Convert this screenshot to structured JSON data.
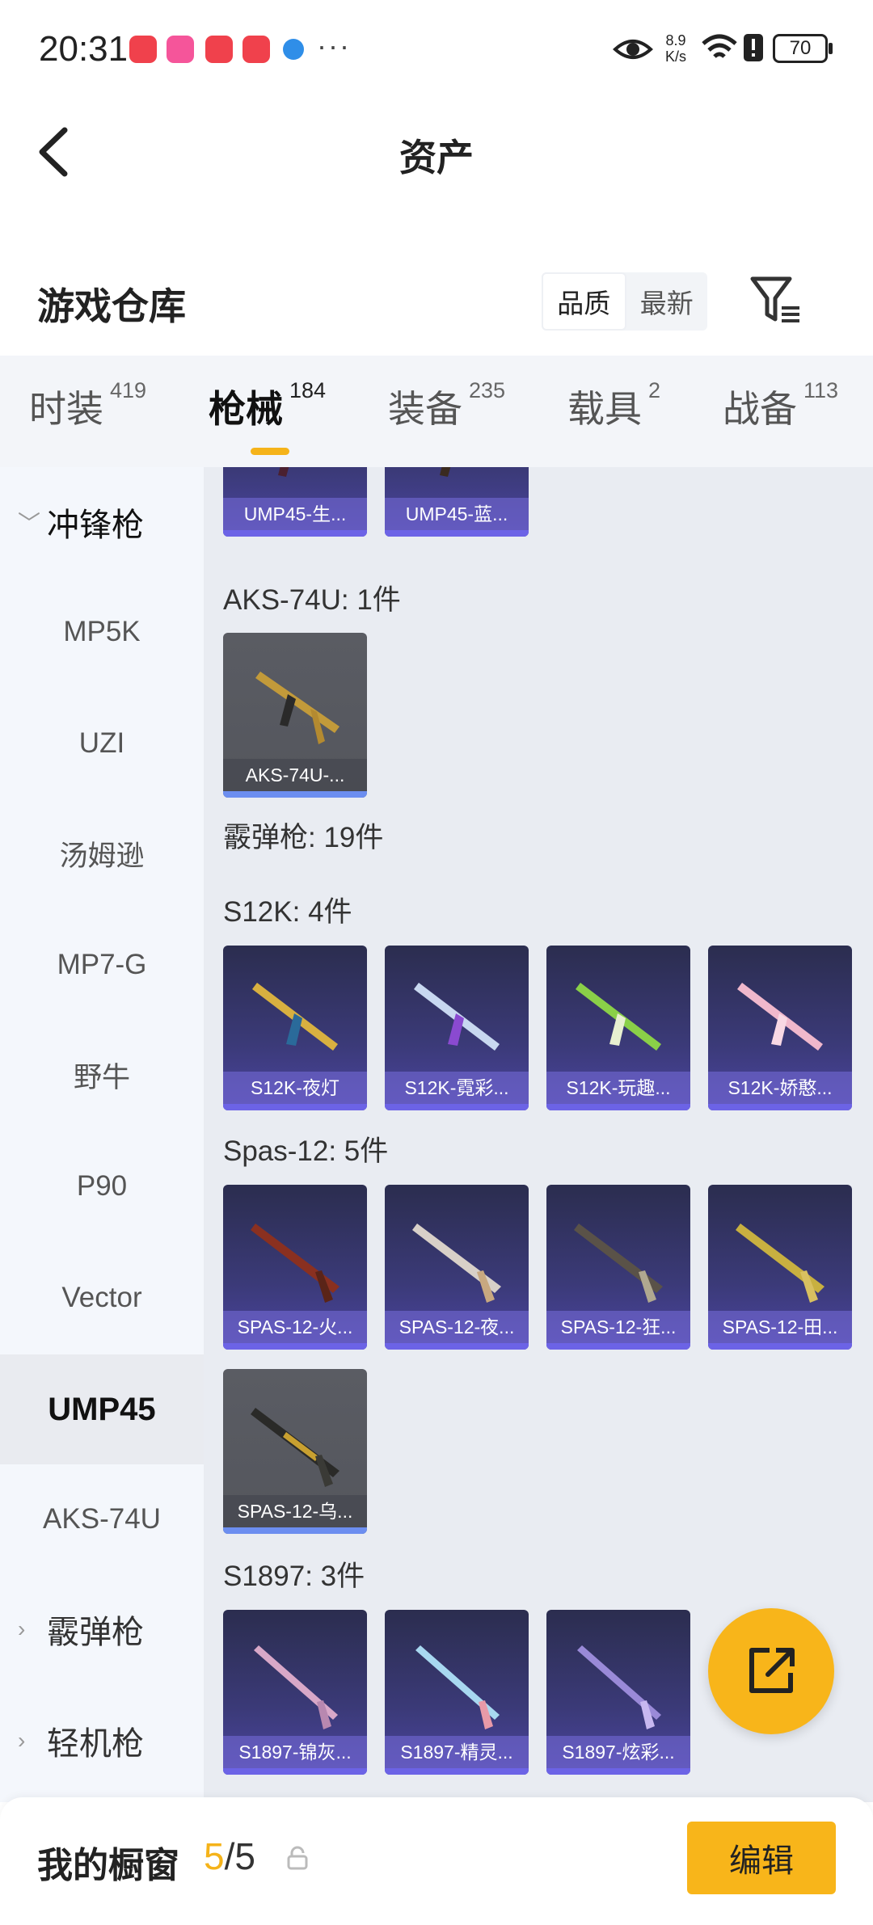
{
  "status_bar": {
    "time": "20:31",
    "app_icon_colors": [
      "#f0414c",
      "#f5559a",
      "#f0414c",
      "#f0414c",
      "#2f8ee8"
    ],
    "more": "···",
    "net_speed_top": "8.9",
    "net_speed_bottom": "K/s",
    "battery": "70"
  },
  "header": {
    "title": "资产",
    "back_icon": "chevron-left-icon"
  },
  "warehouse": {
    "title": "游戏仓库",
    "sort_options": [
      "品质",
      "最新"
    ],
    "sort_selected": "品质",
    "filter_icon": "filter-icon"
  },
  "tabs": [
    {
      "label": "时装",
      "count": "419"
    },
    {
      "label": "枪械",
      "count": "184"
    },
    {
      "label": "装备",
      "count": "235"
    },
    {
      "label": "载具",
      "count": "2"
    },
    {
      "label": "战备",
      "count": "113"
    }
  ],
  "active_tab": "枪械",
  "sidebar": {
    "group_open": "冲锋枪",
    "items": [
      "MP5K",
      "UZI",
      "汤姆逊",
      "MP7-G",
      "野牛",
      "P90",
      "Vector",
      "UMP45",
      "AKS-74U"
    ],
    "selected": "UMP45",
    "groups_closed": [
      "霰弹枪",
      "轻机枪"
    ]
  },
  "content": {
    "top_cards": [
      "UMP45-生...",
      "UMP45-蓝..."
    ],
    "aks_header": "AKS-74U: 1件",
    "aks_cards": [
      "AKS-74U-..."
    ],
    "shotgun_header": "霰弹枪: 19件",
    "s12k_header": "S12K: 4件",
    "s12k_cards": [
      "S12K-夜灯",
      "S12K-霓彩...",
      "S12K-玩趣...",
      "S12K-娇憨..."
    ],
    "spas_header": "Spas-12: 5件",
    "spas_cards": [
      "SPAS-12-火...",
      "SPAS-12-夜...",
      "SPAS-12-狂...",
      "SPAS-12-田...",
      "SPAS-12-乌..."
    ],
    "s1897_header": "S1897: 3件",
    "s1897_cards": [
      "S1897-锦灰...",
      "S1897-精灵...",
      "S1897-炫彩..."
    ]
  },
  "fab_icon": "share-icon",
  "bottom_bar": {
    "label": "我的橱窗",
    "count_used": "5",
    "count_total": "/5",
    "lock_icon": "lock-icon",
    "edit_label": "编辑"
  },
  "colors": {
    "accent": "#f8b51a",
    "card_purple": "#3b3a78",
    "card_gray": "#56585f"
  }
}
